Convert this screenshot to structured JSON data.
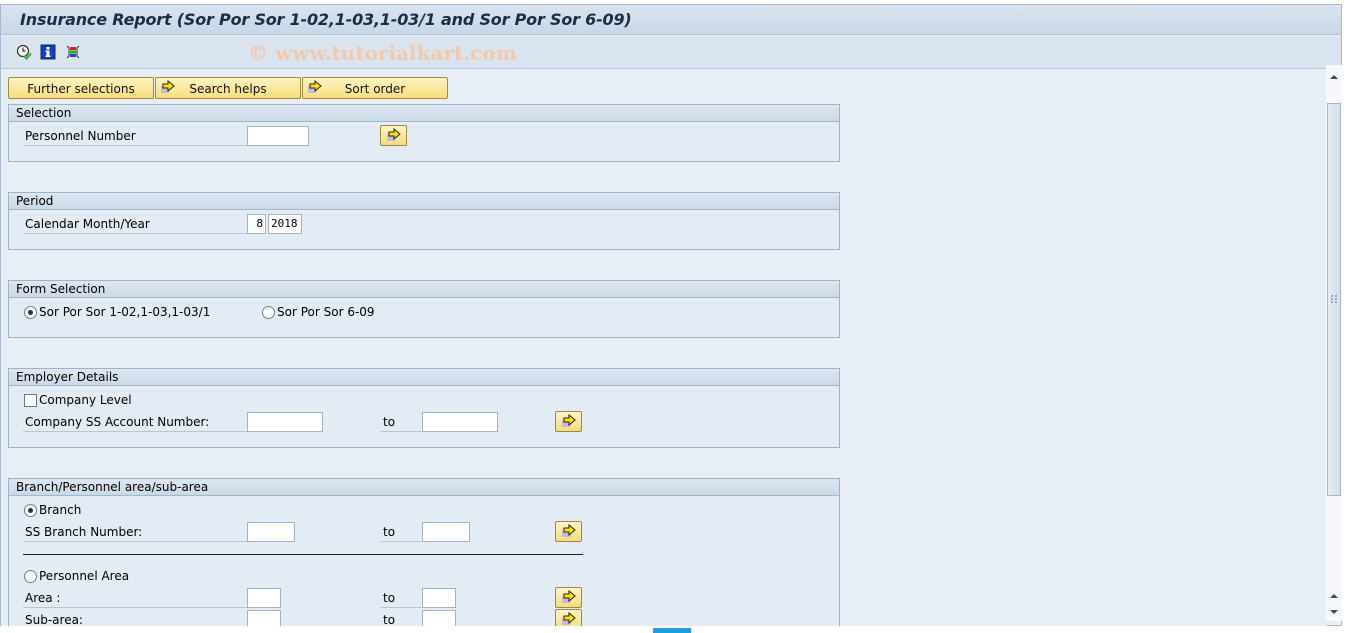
{
  "window": {
    "title": "Insurance Report (Sor Por Sor 1-02,1-03,1-03/1 and Sor Por Sor 6-09)",
    "watermark": "© www.tutorialkart.com"
  },
  "toolbar": {
    "icons": [
      "execute-clock-icon",
      "information-icon",
      "selection-options-icon"
    ]
  },
  "buttons": {
    "further_selections": "Further selections",
    "search_helps": "Search helps",
    "sort_order": "Sort order"
  },
  "groups": {
    "selection": {
      "title": "Selection",
      "personnel_number_label": "Personnel Number",
      "personnel_number_value": ""
    },
    "period": {
      "title": "Period",
      "calendar_label": "Calendar Month/Year",
      "month_value": "8",
      "year_value": "2018"
    },
    "form_selection": {
      "title": "Form Selection",
      "option1_label": "Sor Por Sor 1-02,1-03,1-03/1",
      "option1_selected": true,
      "option2_label": "Sor Por Sor 6-09",
      "option2_selected": false
    },
    "employer_details": {
      "title": "Employer Details",
      "company_level_label": "Company Level",
      "company_level_checked": false,
      "account_label": "Company SS Account Number:",
      "account_from": "",
      "to_label": "to",
      "account_to": ""
    },
    "branch": {
      "title": "Branch/Personnel area/sub-area",
      "branch_radio_label": "Branch",
      "branch_selected": true,
      "branch_number_label": "SS Branch Number:",
      "branch_from": "",
      "branch_to": "",
      "to_label": "to",
      "personnel_area_radio_label": "Personnel Area",
      "personnel_area_selected": false,
      "area_label": "Area :",
      "area_from": "",
      "area_to": "",
      "subarea_label": "Sub-area:",
      "subarea_from": "",
      "subarea_to": ""
    }
  }
}
